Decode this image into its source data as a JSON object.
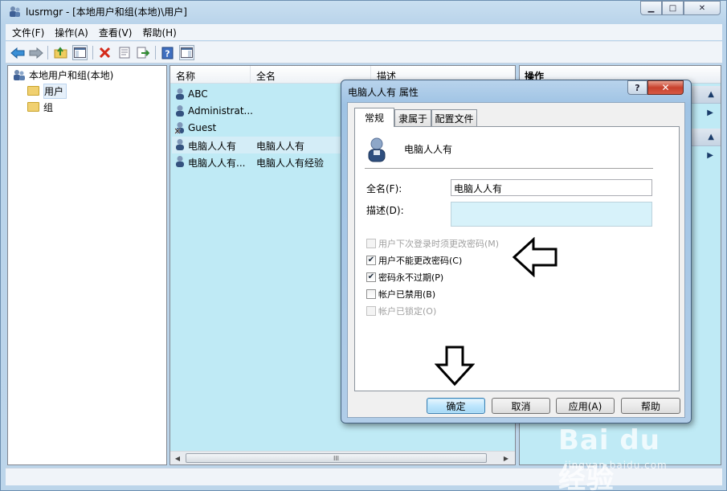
{
  "window": {
    "title": "lusrmgr - [本地用户和组(本地)\\用户]"
  },
  "menu": {
    "items": [
      "文件(F)",
      "操作(A)",
      "查看(V)",
      "帮助(H)"
    ]
  },
  "tree": {
    "root": "本地用户和组(本地)",
    "users": "用户",
    "groups": "组"
  },
  "list": {
    "columns": {
      "name": "名称",
      "fullname": "全名",
      "description": "描述"
    },
    "rows": [
      {
        "name": "ABC",
        "fullname": ""
      },
      {
        "name": "Administrat...",
        "fullname": ""
      },
      {
        "name": "Guest",
        "fullname": ""
      },
      {
        "name": "电脑人人有",
        "fullname": "电脑人人有"
      },
      {
        "name": "电脑人人有...",
        "fullname": "电脑人人有经验"
      }
    ],
    "scroll_grip": "III"
  },
  "actions": {
    "title": "操作"
  },
  "dialog": {
    "title": "电脑人人有 属性",
    "tabs": {
      "general": "常规",
      "member_of": "隶属于",
      "profile": "配置文件"
    },
    "user_heading": "电脑人人有",
    "fullname_label": "全名(F):",
    "fullname_value": "电脑人人有",
    "description_label": "描述(D):",
    "description_value": "",
    "checkboxes": [
      {
        "label": "用户下次登录时须更改密码(M)",
        "checked": false,
        "disabled": true
      },
      {
        "label": "用户不能更改密码(C)",
        "checked": true,
        "disabled": false
      },
      {
        "label": "密码永不过期(P)",
        "checked": true,
        "disabled": false
      },
      {
        "label": "帐户已禁用(B)",
        "checked": false,
        "disabled": false
      },
      {
        "label": "帐户已锁定(O)",
        "checked": false,
        "disabled": true
      }
    ],
    "buttons": {
      "ok": "确定",
      "cancel": "取消",
      "apply": "应用(A)",
      "help": "帮助"
    }
  },
  "watermark": {
    "logo": "Bai du 经验",
    "url": "jingyan.baidu.com"
  },
  "icons": {
    "back": "back-arrow-icon",
    "forward": "forward-arrow-icon",
    "up": "up-folder-icon",
    "show_tree": "show-hide-tree-icon",
    "delete": "delete-icon",
    "properties": "properties-icon",
    "export": "export-list-icon",
    "help": "help-icon",
    "mmc": "mmc-pane-icon"
  },
  "colors": {
    "list_bg": "#bfeaf5",
    "delete_red": "#d42a1a",
    "selected_row": "#d4edf7"
  }
}
